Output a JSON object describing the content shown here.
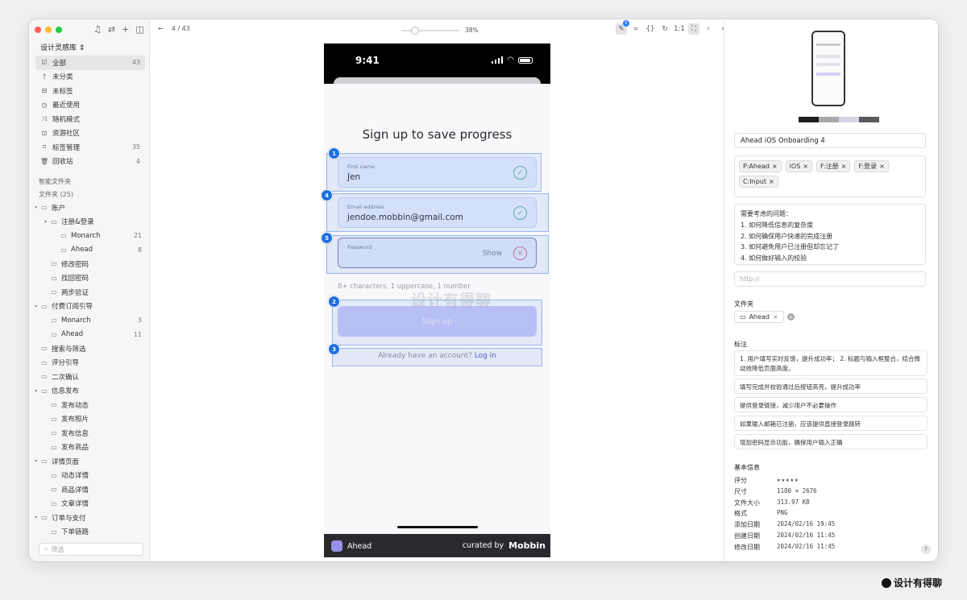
{
  "sidebar": {
    "library_title": "设计灵感库",
    "nav": [
      {
        "icon": "☑",
        "label": "全部",
        "count": "43"
      },
      {
        "icon": "?",
        "label": "未分类",
        "count": ""
      },
      {
        "icon": "⊟",
        "label": "未标签",
        "count": ""
      },
      {
        "icon": "◷",
        "label": "最近使用",
        "count": ""
      },
      {
        "icon": "⤨",
        "label": "随机模式",
        "count": ""
      },
      {
        "icon": "⊡",
        "label": "资源社区",
        "count": ""
      },
      {
        "icon": "⌑",
        "label": "标签管理",
        "count": "35"
      },
      {
        "icon": "🗑",
        "label": "回收站",
        "count": "4"
      }
    ],
    "smart_folders_label": "智能文件夹",
    "folders_label": "文件夹 (25)",
    "tree": [
      {
        "label": "账户",
        "count": "",
        "level": 0,
        "caret": true
      },
      {
        "label": "注册&登录",
        "count": "",
        "level": 1,
        "caret": true
      },
      {
        "label": "Monarch",
        "count": "21",
        "level": 2,
        "caret": false
      },
      {
        "label": "Ahead",
        "count": "8",
        "level": 2,
        "caret": false
      },
      {
        "label": "修改密码",
        "count": "",
        "level": 1,
        "caret": false
      },
      {
        "label": "找回密码",
        "count": "",
        "level": 1,
        "caret": false
      },
      {
        "label": "两步验证",
        "count": "",
        "level": 1,
        "caret": false
      },
      {
        "label": "付费订阅引导",
        "count": "",
        "level": 0,
        "caret": true
      },
      {
        "label": "Monarch",
        "count": "3",
        "level": 1,
        "caret": false
      },
      {
        "label": "Ahead",
        "count": "11",
        "level": 1,
        "caret": false
      },
      {
        "label": "搜索与筛选",
        "count": "",
        "level": 0,
        "caret": false
      },
      {
        "label": "评分引导",
        "count": "",
        "level": 0,
        "caret": false
      },
      {
        "label": "二次确认",
        "count": "",
        "level": 0,
        "caret": false
      },
      {
        "label": "信息发布",
        "count": "",
        "level": 0,
        "caret": true
      },
      {
        "label": "发布动态",
        "count": "",
        "level": 1,
        "caret": false
      },
      {
        "label": "发布照片",
        "count": "",
        "level": 1,
        "caret": false
      },
      {
        "label": "发布信息",
        "count": "",
        "level": 1,
        "caret": false
      },
      {
        "label": "发布商品",
        "count": "",
        "level": 1,
        "caret": false
      },
      {
        "label": "详情页面",
        "count": "",
        "level": 0,
        "caret": true
      },
      {
        "label": "动态详情",
        "count": "",
        "level": 1,
        "caret": false
      },
      {
        "label": "商品详情",
        "count": "",
        "level": 1,
        "caret": false
      },
      {
        "label": "文章详情",
        "count": "",
        "level": 1,
        "caret": false
      },
      {
        "label": "订单与支付",
        "count": "",
        "level": 0,
        "caret": true
      },
      {
        "label": "下单链路",
        "count": "",
        "level": 1,
        "caret": false
      }
    ],
    "filter_placeholder": "筛选"
  },
  "toolbar": {
    "page_indicator": "4 / 43",
    "zoom_label": "38%",
    "zoom_level": 0.2,
    "annotation_count": "5",
    "fit_label": "1:1"
  },
  "phone": {
    "time": "9:41",
    "title": "Sign up to save progress",
    "first_name_label": "First name",
    "first_name_value": "Jen",
    "email_label": "Email address",
    "email_value": "jendoe.mobbin@gmail.com",
    "password_label": "Password",
    "show_label": "Show",
    "hint": "8+ characters, 1 uppercase, 1 number",
    "signup_label": "Sign up",
    "have_account": "Already have an account?",
    "login_label": "Log in",
    "app_name": "Ahead",
    "curated_by": "curated by",
    "brand": "Mobbin"
  },
  "markers": [
    "1",
    "4",
    "5",
    "2",
    "3"
  ],
  "watermark": "设计有得聊",
  "panel": {
    "swatches": [
      "#1e1e1e",
      "#a8a8ad",
      "#d4d4e4",
      "#5a5a5e"
    ],
    "name": "Ahead iOS Onboarding 4",
    "tags": [
      "P:Ahead",
      "iOS",
      "F:注册",
      "F:登录",
      "C:Input"
    ],
    "questions_title": "需要考虑的问题：",
    "questions": [
      "1. 如何降低信息的复杂度",
      "2. 如何确保用户快速的完成注册",
      "3. 如何避免用户已注册但却忘记了",
      "4. 如何做好输入的校验"
    ],
    "url_placeholder": "http://",
    "folder_label": "文件夹",
    "folder_chip": "Ahead",
    "notes_label": "标注",
    "notes": [
      "1. 用户填写实时反馈，提升成功率； 2. 标题与输入框整合，结合微动效降低页面高度。",
      "填写完成并校验通过后按钮高亮，提升成功率",
      "提供登录链接，减少用户不必要操作",
      "如果输入邮箱已注册，应该提供直接登录跳转",
      "增加密码显示功能，确保用户输入正确"
    ],
    "basic_info_label": "基本信息",
    "info": [
      {
        "k": "评分",
        "v": "★★★★★"
      },
      {
        "k": "尺寸",
        "v": "1180 × 2676"
      },
      {
        "k": "文件大小",
        "v": "313.97 KB"
      },
      {
        "k": "格式",
        "v": "PNG"
      },
      {
        "k": "添加日期",
        "v": "2024/02/16 19:45"
      },
      {
        "k": "创建日期",
        "v": "2024/02/16 11:45"
      },
      {
        "k": "修改日期",
        "v": "2024/02/16 11:45"
      }
    ],
    "help": "?"
  }
}
